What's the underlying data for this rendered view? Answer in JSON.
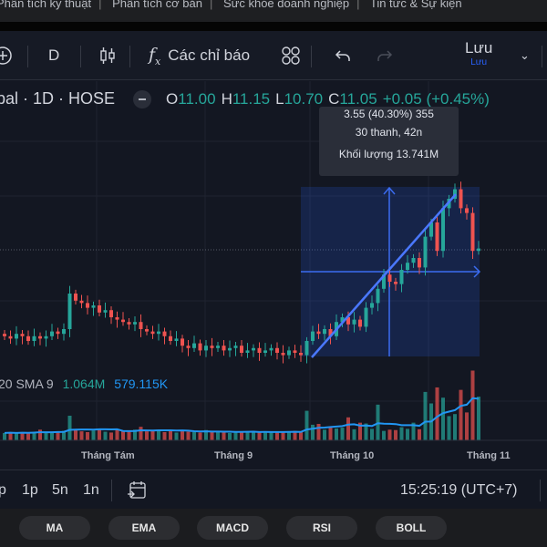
{
  "top_nav": {
    "items": [
      "Phân tích kỹ thuật",
      "Phân tích cơ bản",
      "Sức khỏe doanh nghiệp",
      "Tin tức & Sự kiện"
    ]
  },
  "toolbar": {
    "interval": "D",
    "indicators_label": "Các chỉ báo",
    "save_label": "Lưu",
    "save_sub": "Lưu"
  },
  "legend": {
    "symbol": "bal · 1D · HOSE",
    "o_label": "O",
    "o": "11.00",
    "h_label": "H",
    "h": "11.15",
    "l_label": "L",
    "l": "10.70",
    "c_label": "C",
    "c": "11.05",
    "change": "+0.05 (+0.45%)"
  },
  "measure_tooltip": {
    "line1": "3.55 (40.30%) 355",
    "line2": "30 thanh, 42n",
    "line3": "Khối lượng 13.741M"
  },
  "volume_legend": {
    "label": "20 SMA 9",
    "volume": "1.064M",
    "sma": "579.115K"
  },
  "time_axis": [
    "Tháng Tám",
    "Tháng 9",
    "Tháng 10",
    "Tháng 11"
  ],
  "bottom": {
    "ranges": [
      "p",
      "1p",
      "5n",
      "1n"
    ],
    "clock": "15:25:19 (UTC+7)"
  },
  "indicator_pills": [
    "MA",
    "EMA",
    "MACD",
    "RSI",
    "BOLL"
  ],
  "colors": {
    "up": "#26a69a",
    "down": "#ef5350",
    "accent": "#2962ff",
    "sma": "#2196f3"
  },
  "chart_data": {
    "type": "candlestick",
    "closes": [
      9.2,
      9.15,
      9.25,
      9.2,
      9.1,
      9.2,
      9.15,
      9.2,
      9.3,
      9.25,
      9.35,
      10.1,
      9.95,
      9.9,
      9.8,
      9.85,
      9.7,
      9.75,
      9.6,
      9.55,
      9.5,
      9.45,
      9.5,
      9.35,
      9.3,
      9.25,
      9.3,
      9.2,
      9.1,
      9.15,
      9.0,
      8.95,
      9.05,
      8.9,
      9.0,
      8.95,
      9.0,
      8.9,
      8.95,
      9.0,
      8.85,
      8.9,
      8.95,
      8.85,
      8.9,
      8.95,
      8.85,
      8.8,
      8.9,
      8.85,
      8.8,
      9.1,
      9.3,
      9.25,
      9.35,
      9.2,
      9.5,
      9.6,
      9.45,
      9.55,
      9.4,
      9.8,
      9.9,
      10.2,
      10.5,
      10.35,
      10.3,
      10.6,
      10.75,
      10.85,
      10.65,
      11.3,
      11.6,
      11.0,
      11.9,
      12.1,
      12.3,
      11.9,
      11.8,
      11.0,
      11.05
    ],
    "volumes_k": [
      180,
      190,
      170,
      200,
      180,
      210,
      260,
      190,
      200,
      220,
      230,
      600,
      250,
      220,
      200,
      240,
      260,
      210,
      190,
      260,
      230,
      210,
      260,
      330,
      220,
      240,
      250,
      200,
      260,
      190,
      220,
      210,
      200,
      190,
      250,
      200,
      210,
      230,
      180,
      190,
      210,
      220,
      200,
      190,
      210,
      200,
      220,
      190,
      210,
      230,
      200,
      720,
      380,
      400,
      260,
      330,
      290,
      310,
      560,
      270,
      430,
      410,
      280,
      870,
      230,
      260,
      250,
      320,
      280,
      430,
      270,
      1180,
      900,
      1290,
      1040,
      590,
      640,
      1230,
      680,
      1700,
      1064
    ],
    "measure": {
      "change": 3.55,
      "percent": 40.3,
      "bars": 30
    }
  }
}
